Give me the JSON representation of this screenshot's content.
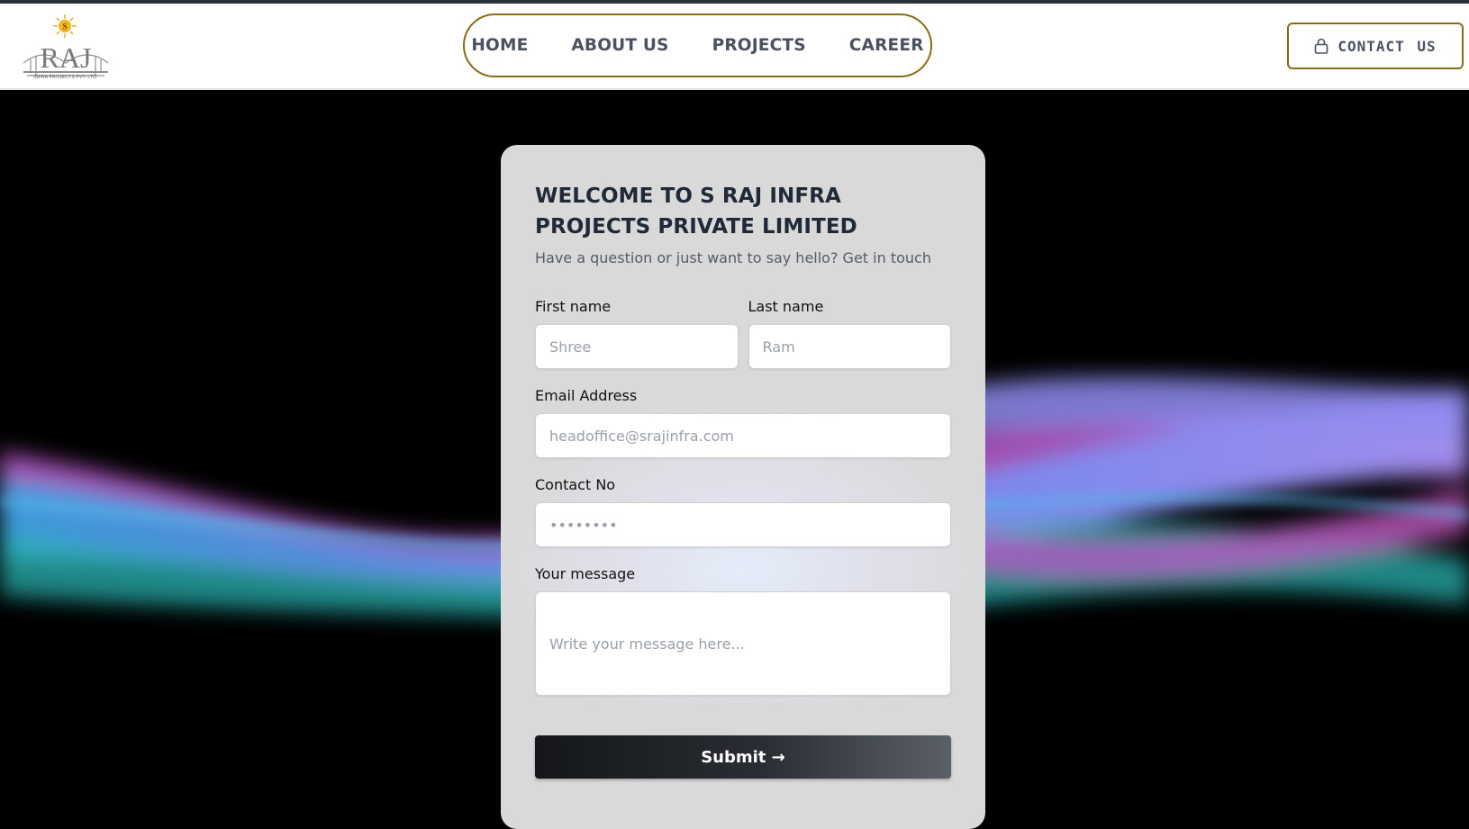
{
  "brand": {
    "logo_text": "RAJ",
    "logo_subtext": "INFRA PROJECTS PVT. LTD."
  },
  "nav": {
    "items": [
      {
        "label": "HOME"
      },
      {
        "label": "ABOUT US"
      },
      {
        "label": "PROJECTS"
      },
      {
        "label": "CAREER"
      }
    ],
    "contact_label": "CONTACT US"
  },
  "form": {
    "title": "WELCOME TO S RAJ INFRA PROJECTS PRIVATE LIMITED",
    "subtitle": "Have a question or just want to say hello? Get in touch",
    "first_name": {
      "label": "First name",
      "placeholder": "Shree"
    },
    "last_name": {
      "label": "Last name",
      "placeholder": "Ram"
    },
    "email": {
      "label": "Email Address",
      "placeholder": "headoffice@srajinfra.com"
    },
    "contact": {
      "label": "Contact No",
      "placeholder": "••••••••"
    },
    "message": {
      "label": "Your message",
      "placeholder": "Write your message here..."
    },
    "submit_label": "Submit →"
  },
  "colors": {
    "accent_border": "#8a6a16",
    "nav_text": "#4a5161",
    "hero_background": "#000000",
    "card_background": "#d9d9d9"
  },
  "icons": {
    "contact": "lock-icon",
    "logo_sun": "sun-icon"
  }
}
